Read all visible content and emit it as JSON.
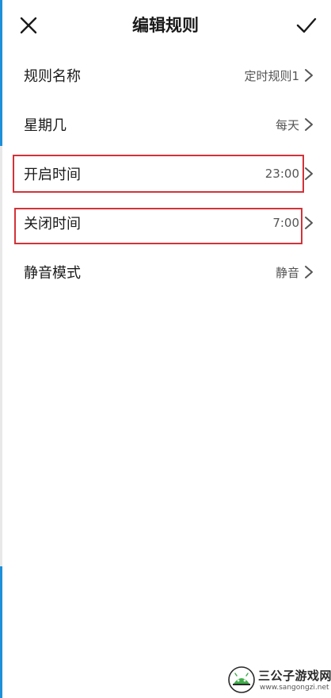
{
  "header": {
    "title": "编辑规则",
    "close_icon": "close-icon",
    "confirm_icon": "check-icon"
  },
  "rows": [
    {
      "label": "规则名称",
      "value": "定时规则1",
      "highlighted": false
    },
    {
      "label": "星期几",
      "value": "每天",
      "highlighted": false
    },
    {
      "label": "开启时间",
      "value": "23:00",
      "highlighted": true
    },
    {
      "label": "关闭时间",
      "value": "7:00",
      "highlighted": true
    },
    {
      "label": "静音模式",
      "value": "静音",
      "highlighted": false
    }
  ],
  "watermark": {
    "name": "三公子游戏网",
    "url": "www.sangongzi.net"
  },
  "colors": {
    "highlight": "#d2333a",
    "edge_accent": "#1f8fd8",
    "text_primary": "#1a1a1a",
    "text_secondary": "#555555"
  }
}
